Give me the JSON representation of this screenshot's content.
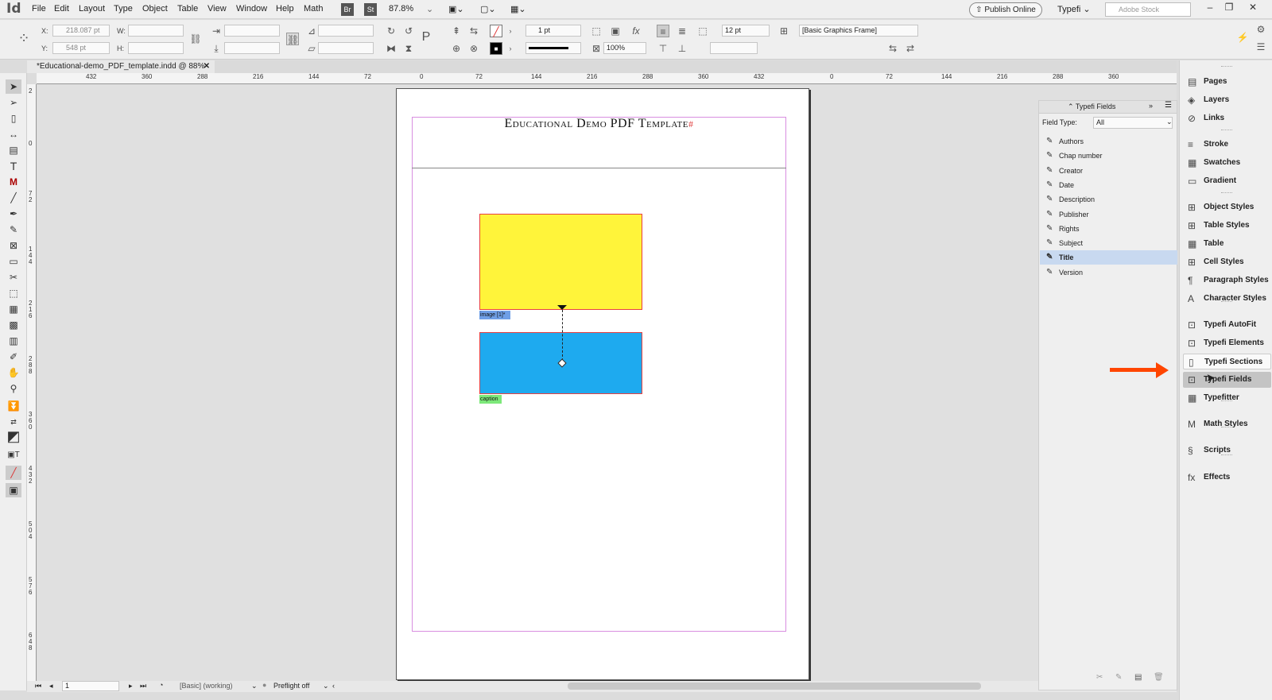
{
  "menubar": {
    "app_id": "Id",
    "menus": [
      "File",
      "Edit",
      "Layout",
      "Type",
      "Object",
      "Table",
      "View",
      "Window",
      "Help",
      "Math"
    ],
    "bridge": "Br",
    "stock": "St",
    "zoom": "87.8%",
    "publish_online": "Publish Online",
    "typefi": "Typefi",
    "search_placeholder": "Adobe Stock"
  },
  "control_bar": {
    "x_label": "X:",
    "x_value": "218.087 pt",
    "y_label": "Y:",
    "y_value": "548 pt",
    "w_label": "W:",
    "h_label": "H:",
    "stroke_weight": "1 pt",
    "opacity": "100%",
    "spacing": "12 pt",
    "object_style": "[Basic Graphics Frame]"
  },
  "document": {
    "tab_title": "*Educational-demo_PDF_template.indd @ 88%",
    "page_title": "Educational Demo PDF Template",
    "title_marker": "#",
    "image_label": "image [1]*",
    "caption_label": "caption",
    "colors": {
      "yellow": "#fff43a",
      "blue": "#1eaaef",
      "frame_red": "#e84040",
      "margin_magenta": "#d88ee0"
    }
  },
  "ruler": {
    "h_ticks": [
      "432",
      "360",
      "288",
      "216",
      "144",
      "72",
      "0",
      "72",
      "144",
      "216",
      "288",
      "360",
      "432",
      "0",
      "72",
      "144",
      "216",
      "288",
      "360"
    ],
    "v_ticks": [
      "2",
      "0",
      "7 2",
      "1 4 4",
      "2 1 6",
      "2 8 8",
      "3 6 0",
      "4 3 2",
      "5 0 4",
      "5 7 6",
      "6 4 8"
    ]
  },
  "status": {
    "page_number": "1",
    "master": "[Basic] (working)",
    "preflight": "Preflight off"
  },
  "typefi_fields": {
    "panel_title": "Typefi Fields",
    "field_type_label": "Field Type:",
    "field_type_value": "All",
    "selected": "Title",
    "items": [
      "Authors",
      "Chap number",
      "Creator",
      "Date",
      "Description",
      "Publisher",
      "Rights",
      "Subject",
      "Title",
      "Version"
    ]
  },
  "dock": {
    "items": [
      {
        "label": "Pages",
        "icon": "pages-icon"
      },
      {
        "label": "Layers",
        "icon": "layers-icon"
      },
      {
        "label": "Links",
        "icon": "links-icon"
      },
      {
        "label": "Stroke",
        "icon": "stroke-icon"
      },
      {
        "label": "Swatches",
        "icon": "swatches-icon"
      },
      {
        "label": "Gradient",
        "icon": "gradient-icon"
      },
      {
        "label": "Object Styles",
        "icon": "object-styles-icon"
      },
      {
        "label": "Table Styles",
        "icon": "table-styles-icon"
      },
      {
        "label": "Table",
        "icon": "table-icon"
      },
      {
        "label": "Cell Styles",
        "icon": "cell-styles-icon"
      },
      {
        "label": "Paragraph Styles",
        "icon": "paragraph-styles-icon"
      },
      {
        "label": "Character Styles",
        "icon": "character-styles-icon"
      },
      {
        "label": "Typefi AutoFit",
        "icon": "typefi-autofit-icon"
      },
      {
        "label": "Typefi Elements",
        "icon": "typefi-elements-icon"
      },
      {
        "label": "Typefi Sections",
        "icon": "typefi-sections-icon"
      },
      {
        "label": "Typefi Fields",
        "icon": "typefi-fields-icon"
      },
      {
        "label": "Typefitter",
        "icon": "typefitter-icon"
      },
      {
        "label": "Math Styles",
        "icon": "math-styles-icon"
      },
      {
        "label": "Scripts",
        "icon": "scripts-icon"
      },
      {
        "label": "Effects",
        "icon": "effects-icon"
      }
    ],
    "active": "Typefi Fields",
    "hovered": "Typefi Sections",
    "arrow_color": "#ff4500"
  }
}
